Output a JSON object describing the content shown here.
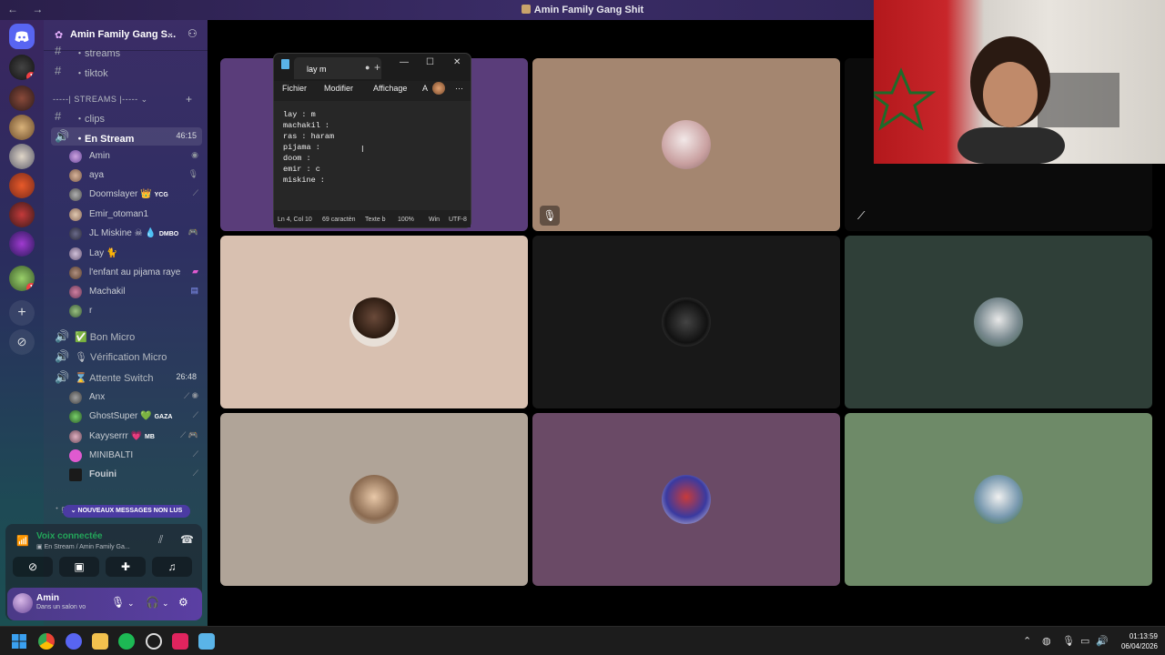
{
  "window": {
    "title": "Amin Family Gang Shit",
    "nav_arrows": "← →"
  },
  "server": {
    "name": "Amin Family Gang S...",
    "dropdown_icon": "chevron-down-icon",
    "invite_icon": "add-user-icon"
  },
  "server_badges": [
    "1",
    "1"
  ],
  "channels": {
    "streams": "・streams",
    "tiktok": "・tiktok",
    "category": "-----| STREAMS |-----",
    "clips": "・clips",
    "en_stream": {
      "label": "・En Stream",
      "time": "46:15"
    },
    "bon_micro": "Bon Micro",
    "verification": "Vérification Micro",
    "attente": {
      "label": "Attente Switch",
      "time": "26:48"
    }
  },
  "en_stream_users": [
    {
      "name": "Amin"
    },
    {
      "name": "aya"
    },
    {
      "name": "Doomslayer",
      "tag": "YCG"
    },
    {
      "name": "Emir_otoman1"
    },
    {
      "name": "JL Miskine",
      "tag": "DMBO"
    },
    {
      "name": "Lay"
    },
    {
      "name": "l'enfant au pijama raye"
    },
    {
      "name": "Machakil"
    },
    {
      "name": "r"
    }
  ],
  "attente_users": [
    {
      "name": "Anx"
    },
    {
      "name": "GhostSuper",
      "tag": "GAZA"
    },
    {
      "name": "Kayyserrr",
      "tag": "MB"
    },
    {
      "name": "MINIBALTI"
    },
    {
      "name": "Fouini"
    }
  ],
  "new_messages": "NOUVEAUX MESSAGES NON LUS",
  "hidden_channel": "・général",
  "voice": {
    "status": "Voix connectée",
    "location": "En Stream / Amin Family Ga..."
  },
  "user": {
    "name": "Amin",
    "status": "Dans un salon vo"
  },
  "notepad": {
    "tab_title": "lay m",
    "menu": [
      "Fichier",
      "Modifier",
      "Affichage"
    ],
    "lines": [
      "lay : m",
      "machakil :",
      "ras : haram",
      "pijama :",
      "doom :",
      "emir : c",
      "miskine :"
    ],
    "status": {
      "position": "Ln 4, Col 10",
      "chars": "69 caractèn",
      "format": "Texte b",
      "zoom": "100%",
      "eol": "Win",
      "encoding": "UTF-8"
    }
  },
  "taskbar": {
    "time": "01:13:59",
    "date": "06/04/2026"
  },
  "colors": {
    "accent": "#5865f2",
    "green": "#23a55a",
    "red": "#f23f43",
    "blurple_pill": "#4b3ba3"
  }
}
